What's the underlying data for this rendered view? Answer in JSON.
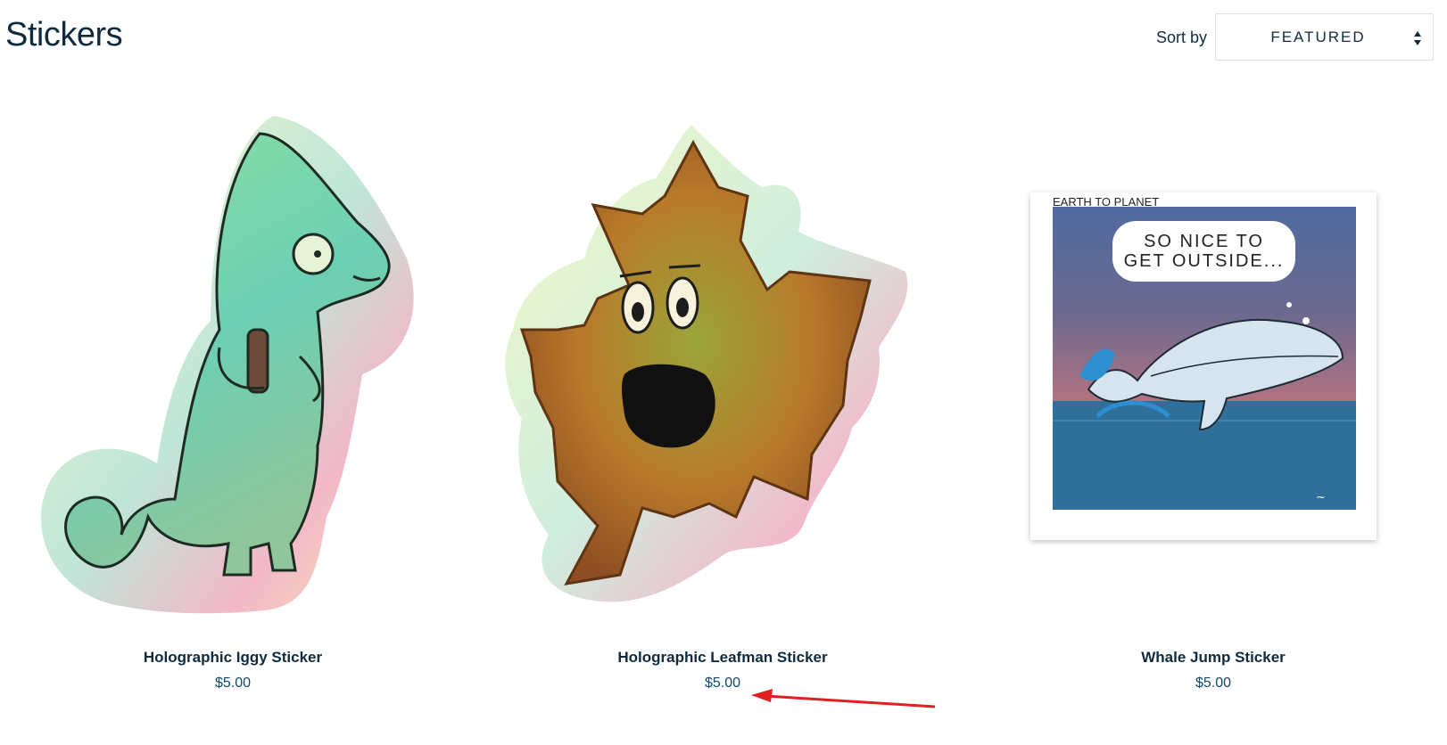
{
  "page": {
    "title": "Stickers"
  },
  "sort": {
    "label": "Sort by",
    "value": "FEATURED"
  },
  "products": [
    {
      "name": "Holographic Iggy Sticker",
      "price": "$5.00"
    },
    {
      "name": "Holographic Leafman Sticker",
      "price": "$5.00"
    },
    {
      "name": "Whale Jump Sticker",
      "price": "$5.00",
      "comic_header": "EARTH TO PLANET",
      "bubble_line1": "SO NICE TO",
      "bubble_line2": "GET OUTSIDE..."
    }
  ],
  "colors": {
    "text": "#0f2b3d",
    "price": "#0f4a6e",
    "annotation_arrow": "#e02020"
  }
}
